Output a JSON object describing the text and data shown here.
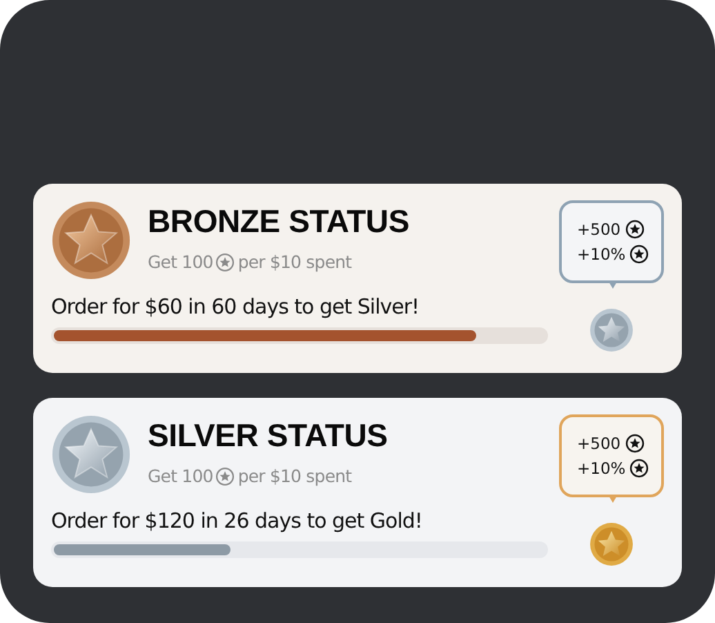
{
  "cards": [
    {
      "kind": "bronze",
      "title": "BRONZE STATUS",
      "rate_before": "Get 100",
      "rate_after": "per $10 spent",
      "goal": "Order for $60 in 60 days to get Silver!",
      "level": 0.86,
      "next_medal": {
        "kind": "silver"
      },
      "bonuses": [
        "+500",
        "+10%"
      ]
    },
    {
      "kind": "silver",
      "title": "SILVER STATUS",
      "rate_before": "Get 100",
      "rate_after": "per $10 spent",
      "goal": "Order for $120 in 26 days to get Gold!",
      "level": 0.36,
      "next_medal": {
        "kind": "gold"
      },
      "bonuses": [
        "+500",
        "+10%"
      ]
    }
  ]
}
